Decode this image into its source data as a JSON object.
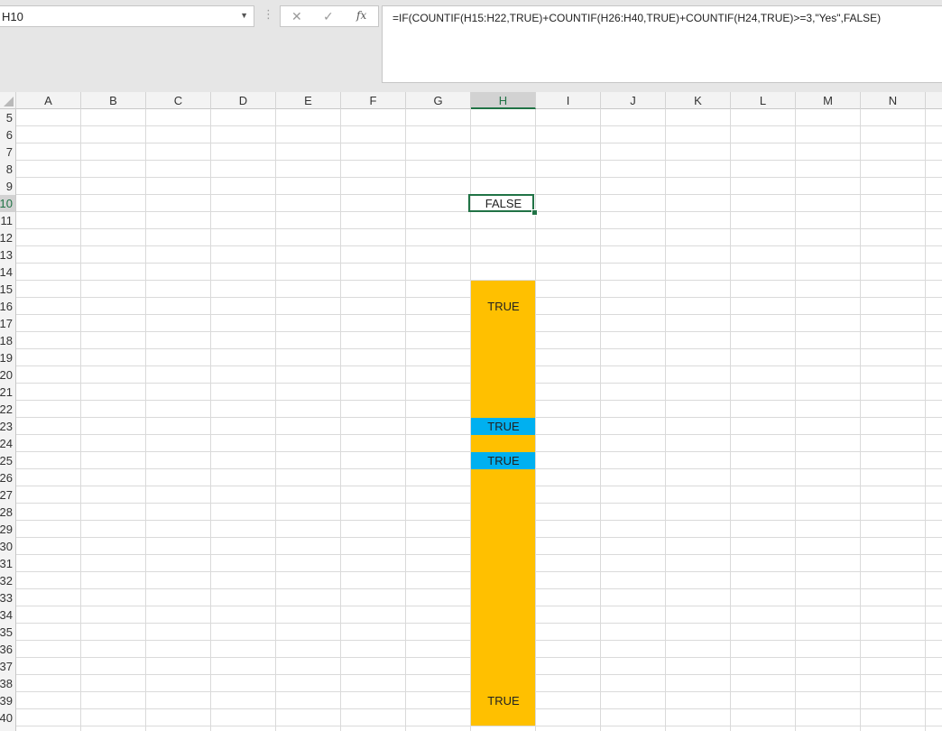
{
  "name_box": {
    "value": "H10"
  },
  "formula_bar": {
    "cancel_glyph": "✕",
    "enter_glyph": "✓",
    "fx_glyph": "fx",
    "formula": "=IF(COUNTIF(H15:H22,TRUE)+COUNTIF(H26:H40,TRUE)+COUNTIF(H24,TRUE)>=3,\"Yes\",FALSE)"
  },
  "columns": [
    "A",
    "B",
    "C",
    "D",
    "E",
    "F",
    "G",
    "H",
    "I",
    "J",
    "K",
    "L",
    "M",
    "N"
  ],
  "selected_column": "H",
  "rows": [
    "5",
    "6",
    "7",
    "8",
    "9",
    "10",
    "11",
    "12",
    "13",
    "14",
    "15",
    "16",
    "17",
    "18",
    "19",
    "20",
    "21",
    "22",
    "23",
    "24",
    "25",
    "26",
    "27",
    "28",
    "29",
    "30",
    "31",
    "32",
    "33",
    "34",
    "35",
    "36",
    "37",
    "38",
    "39",
    "40"
  ],
  "selected_row": "10",
  "colors": {
    "orange": "#ffc000",
    "blue": "#00b0f0",
    "selection": "#217346"
  },
  "fills": [
    {
      "range": "H15:H22",
      "color": "orange"
    },
    {
      "range": "H23",
      "color": "blue"
    },
    {
      "range": "H24",
      "color": "orange"
    },
    {
      "range": "H25",
      "color": "blue"
    },
    {
      "range": "H26:H40",
      "color": "orange"
    }
  ],
  "cells": {
    "H10": "FALSE",
    "H16": "TRUE",
    "H23": "TRUE",
    "H25": "TRUE",
    "H39": "TRUE"
  }
}
